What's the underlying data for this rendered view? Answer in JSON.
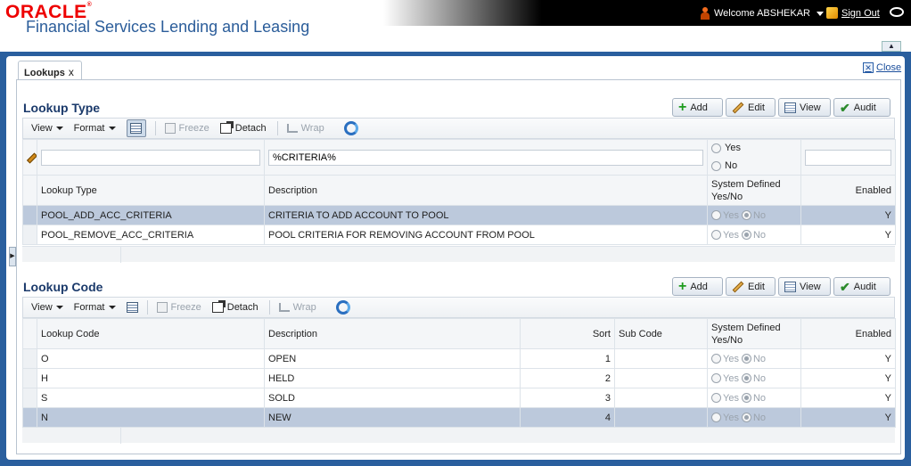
{
  "header": {
    "logo": "ORACLE",
    "app_title": "Financial Services Lending and Leasing",
    "welcome": "Welcome ABSHEKAR",
    "sign_out": "Sign Out"
  },
  "tab": {
    "label": "Lookups",
    "close_glyph": "x"
  },
  "close_link": "Close",
  "buttons": {
    "add": "Add",
    "edit": "Edit",
    "view": "View",
    "audit": "Audit"
  },
  "toolbar": {
    "view": "View",
    "format": "Format",
    "freeze": "Freeze",
    "detach": "Detach",
    "wrap": "Wrap"
  },
  "lookup_type": {
    "title": "Lookup Type",
    "filter": {
      "description": "%CRITERIA%",
      "yes": "Yes",
      "no": "No"
    },
    "columns": {
      "type": "Lookup Type",
      "description": "Description",
      "sys_defined": "System Defined Yes/No",
      "enabled": "Enabled"
    },
    "rows": [
      {
        "type": "POOL_ADD_ACC_CRITERIA",
        "description": "CRITERIA TO ADD ACCOUNT TO POOL",
        "yes": "Yes",
        "no": "No",
        "enabled": "Y"
      },
      {
        "type": "POOL_REMOVE_ACC_CRITERIA",
        "description": "POOL CRITERIA FOR REMOVING ACCOUNT FROM POOL",
        "yes": "Yes",
        "no": "No",
        "enabled": "Y"
      }
    ]
  },
  "lookup_code": {
    "title": "Lookup Code",
    "columns": {
      "code": "Lookup Code",
      "description": "Description",
      "sort": "Sort",
      "sub_code": "Sub Code",
      "sys_defined": "System Defined Yes/No",
      "enabled": "Enabled"
    },
    "rows": [
      {
        "code": "O",
        "description": "OPEN",
        "sort": "1",
        "sub_code": "",
        "yes": "Yes",
        "no": "No",
        "enabled": "Y"
      },
      {
        "code": "H",
        "description": "HELD",
        "sort": "2",
        "sub_code": "",
        "yes": "Yes",
        "no": "No",
        "enabled": "Y"
      },
      {
        "code": "S",
        "description": "SOLD",
        "sort": "3",
        "sub_code": "",
        "yes": "Yes",
        "no": "No",
        "enabled": "Y"
      },
      {
        "code": "N",
        "description": "NEW",
        "sort": "4",
        "sub_code": "",
        "yes": "Yes",
        "no": "No",
        "enabled": "Y"
      }
    ]
  }
}
